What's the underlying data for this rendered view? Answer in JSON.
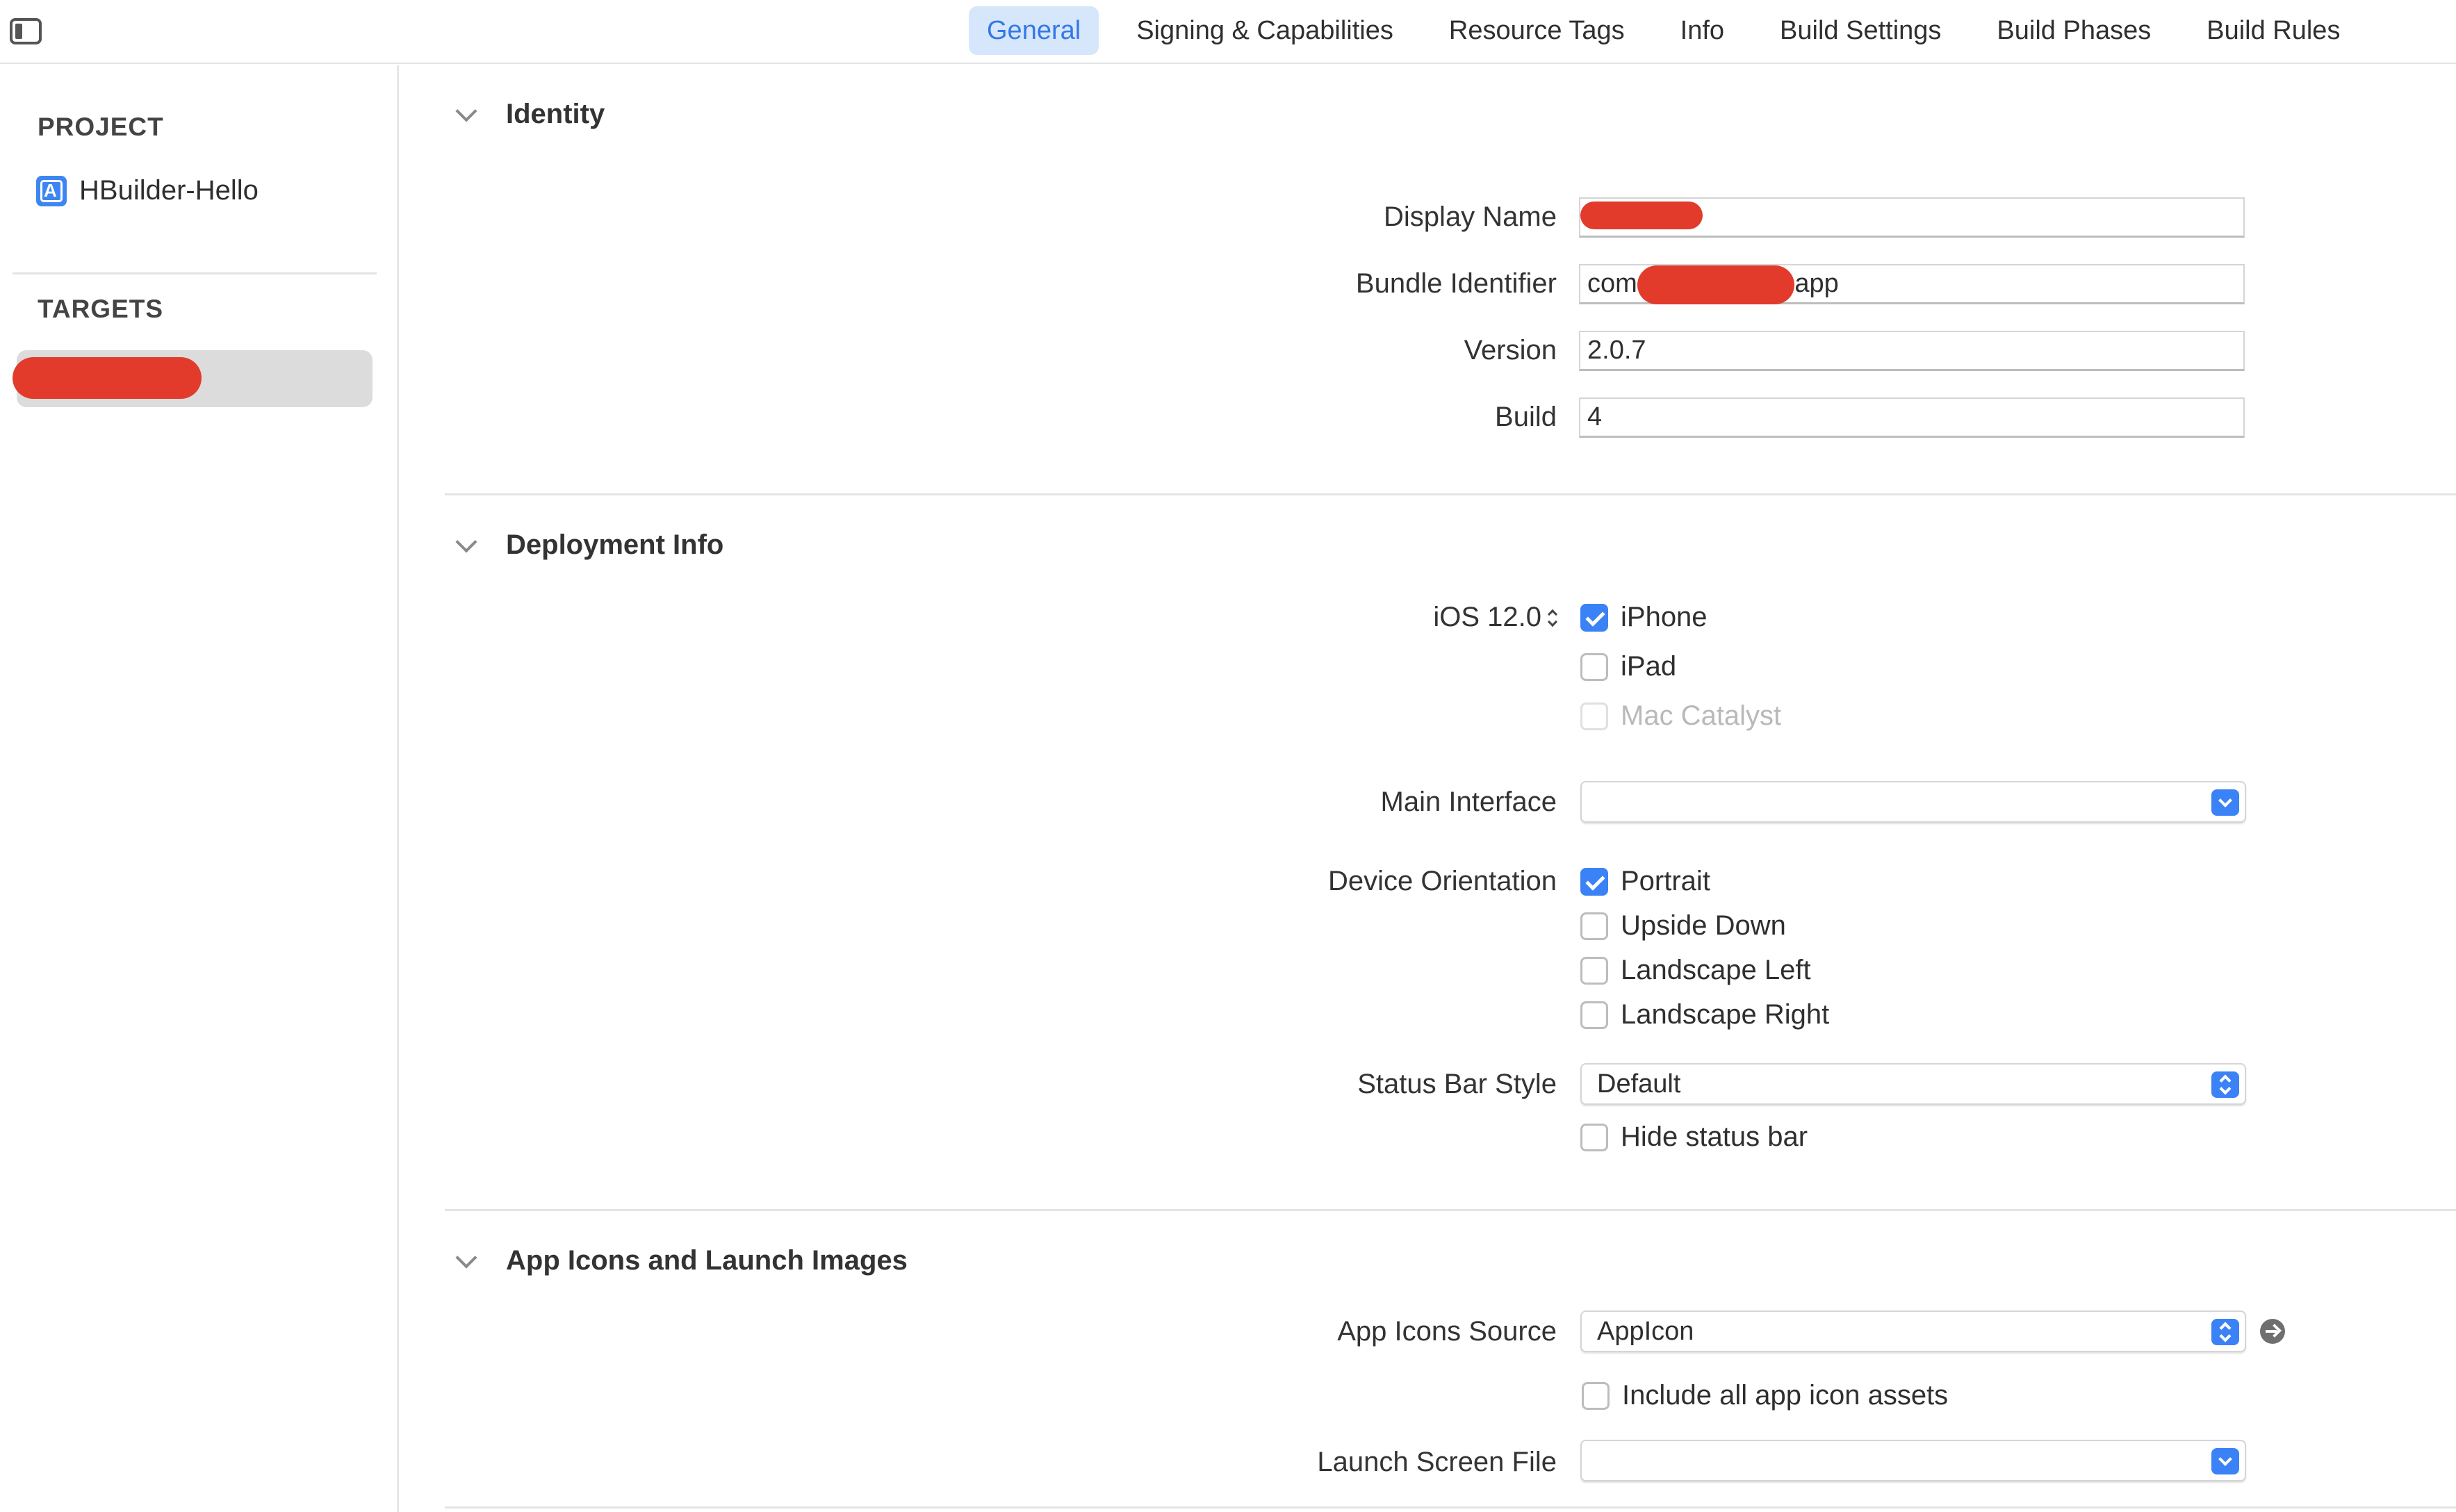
{
  "tabs": [
    {
      "label": "General",
      "active": true
    },
    {
      "label": "Signing & Capabilities"
    },
    {
      "label": "Resource Tags"
    },
    {
      "label": "Info"
    },
    {
      "label": "Build Settings"
    },
    {
      "label": "Build Phases"
    },
    {
      "label": "Build Rules"
    }
  ],
  "sidebar": {
    "project_heading": "PROJECT",
    "project_name": "HBuilder-Hello",
    "targets_heading": "TARGETS"
  },
  "identity": {
    "title": "Identity",
    "display_name_label": "Display Name",
    "display_name_value": "",
    "bundle_id_label": "Bundle Identifier",
    "bundle_id_prefix": "com",
    "bundle_id_suffix": ".app",
    "version_label": "Version",
    "version_value": "2.0.7",
    "build_label": "Build",
    "build_value": "4"
  },
  "deployment": {
    "title": "Deployment Info",
    "ios_label": "iOS 12.0",
    "iphone_label": "iPhone",
    "iphone_checked": true,
    "ipad_label": "iPad",
    "ipad_checked": false,
    "mac_label": "Mac Catalyst",
    "mac_checked": false,
    "main_interface_label": "Main Interface",
    "main_interface_value": "",
    "orientation_label": "Device Orientation",
    "portrait_label": "Portrait",
    "portrait_checked": true,
    "upside_down_label": "Upside Down",
    "landscape_left_label": "Landscape Left",
    "landscape_right_label": "Landscape Right",
    "status_bar_label": "Status Bar Style",
    "status_bar_value": "Default",
    "hide_status_label": "Hide status bar"
  },
  "app_icons": {
    "title": "App Icons and Launch Images",
    "source_label": "App Icons Source",
    "source_value": "AppIcon",
    "include_all_label": "Include all app icon assets",
    "launch_label": "Launch Screen File",
    "launch_value": ""
  },
  "colors": {
    "accent": "#3b82f6",
    "active_tab_bg": "#d6e6fb",
    "redaction": "#e23b2b"
  }
}
